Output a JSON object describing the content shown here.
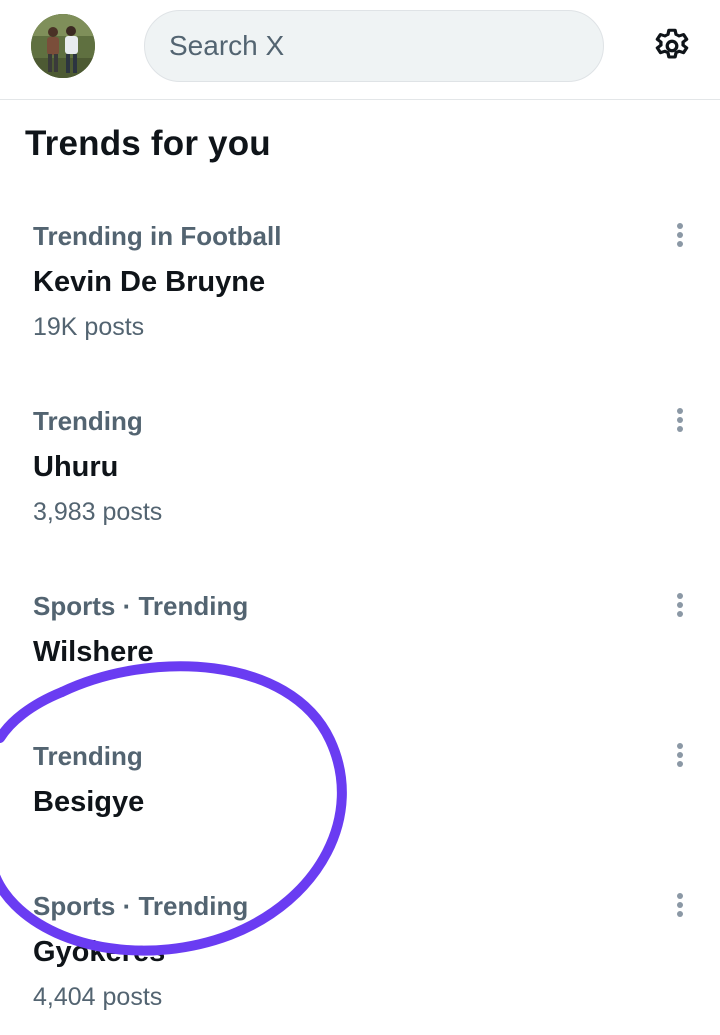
{
  "header": {
    "search_placeholder": "Search X"
  },
  "section_title": "Trends for you",
  "trends": [
    {
      "meta": "Trending in Football",
      "name": "Kevin De Bruyne",
      "count": "19K posts"
    },
    {
      "meta": "Trending",
      "name": "Uhuru",
      "count": "3,983 posts"
    },
    {
      "meta": "Sports · Trending",
      "name": "Wilshere",
      "count": ""
    },
    {
      "meta": "Trending",
      "name": "Besigye",
      "count": ""
    },
    {
      "meta": "Sports · Trending",
      "name": "Gyokeres",
      "count": "4,404 posts"
    }
  ],
  "icons": {
    "settings": "gear-icon",
    "more": "more-vertical-icon"
  },
  "colors": {
    "primary_text": "#0f1419",
    "secondary_text": "#536471",
    "search_bg": "#eff3f4",
    "annotation": "#6a3cf2"
  }
}
